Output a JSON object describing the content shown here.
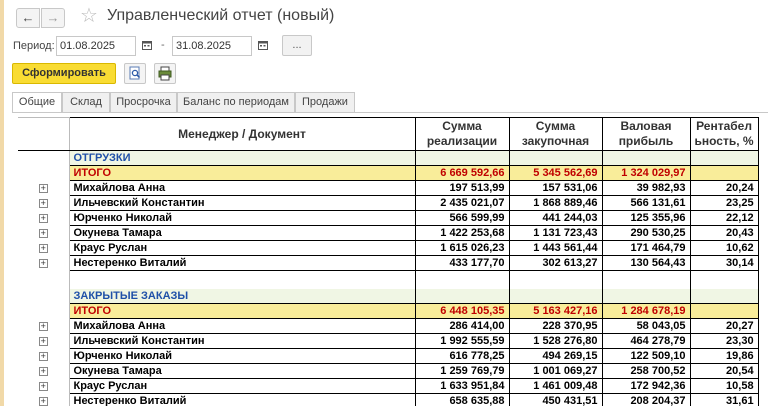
{
  "window": {
    "back_glyph": "←",
    "forward_glyph": "→",
    "star_glyph": "☆",
    "title": "Управленческий отчет (новый)"
  },
  "period": {
    "label": "Период:",
    "from": "01.08.2025",
    "separator": "-",
    "to": "31.08.2025",
    "more_label": "..."
  },
  "toolbar": {
    "generate_label": "Сформировать"
  },
  "tabs": [
    "Общие",
    "Склад",
    "Просрочка",
    "Баланс по периодам",
    "Продажи"
  ],
  "headers": {
    "manager": "Менеджер / Документ",
    "sales_1": "Сумма",
    "sales_2": "реализации",
    "purchase_1": "Сумма",
    "purchase_2": "закупочная",
    "profit_1": "Валовая",
    "profit_2": "прибыль",
    "margin_1": "Рентабел",
    "margin_2": "ьность, %"
  },
  "sections": [
    {
      "title": "ОТГРУЗКИ",
      "total": {
        "label": "ИТОГО",
        "sales": "6 669 592,66",
        "purchase": "5 345 562,69",
        "profit": "1 324 029,97",
        "margin": ""
      },
      "rows": [
        {
          "name": "Михайлова Анна",
          "sales": "197 513,99",
          "purchase": "157 531,06",
          "profit": "39 982,93",
          "margin": "20,24"
        },
        {
          "name": "Ильчевский Константин",
          "sales": "2 435 021,07",
          "purchase": "1 868 889,46",
          "profit": "566 131,61",
          "margin": "23,25"
        },
        {
          "name": "Юрченко Николай",
          "sales": "566 599,99",
          "purchase": "441 244,03",
          "profit": "125 355,96",
          "margin": "22,12"
        },
        {
          "name": "Окунева Тамара",
          "sales": "1 422 253,68",
          "purchase": "1 131 723,43",
          "profit": "290 530,25",
          "margin": "20,43"
        },
        {
          "name": "Краус Руслан",
          "sales": "1 615 026,23",
          "purchase": "1 443 561,44",
          "profit": "171 464,79",
          "margin": "10,62"
        },
        {
          "name": "Нестеренко Виталий",
          "sales": "433 177,70",
          "purchase": "302 613,27",
          "profit": "130 564,43",
          "margin": "30,14"
        }
      ]
    },
    {
      "title": "ЗАКРЫТЫЕ ЗАКАЗЫ",
      "total": {
        "label": "ИТОГО",
        "sales": "6 448 105,35",
        "purchase": "5 163 427,16",
        "profit": "1 284 678,19",
        "margin": ""
      },
      "rows": [
        {
          "name": "Михайлова Анна",
          "sales": "286 414,00",
          "purchase": "228 370,95",
          "profit": "58 043,05",
          "margin": "20,27"
        },
        {
          "name": "Ильчевский Константин",
          "sales": "1 992 555,59",
          "purchase": "1 528 276,80",
          "profit": "464 278,79",
          "margin": "23,30"
        },
        {
          "name": "Юрченко Николай",
          "sales": "616 778,25",
          "purchase": "494 269,15",
          "profit": "122 509,10",
          "margin": "19,86"
        },
        {
          "name": "Окунева Тамара",
          "sales": "1 259 769,79",
          "purchase": "1 001 069,27",
          "profit": "258 700,52",
          "margin": "20,54"
        },
        {
          "name": "Краус Руслан",
          "sales": "1 633 951,84",
          "purchase": "1 461 009,48",
          "profit": "172 942,36",
          "margin": "10,58"
        },
        {
          "name": "Нестеренко Виталий",
          "sales": "658 635,88",
          "purchase": "450 431,51",
          "profit": "208 204,37",
          "margin": "31,61"
        }
      ]
    }
  ],
  "colors": {
    "accent_button": "#f9dc33",
    "section_text": "#1f50a8",
    "total_bg": "#f9ed9a",
    "total_text": "#c00000"
  }
}
